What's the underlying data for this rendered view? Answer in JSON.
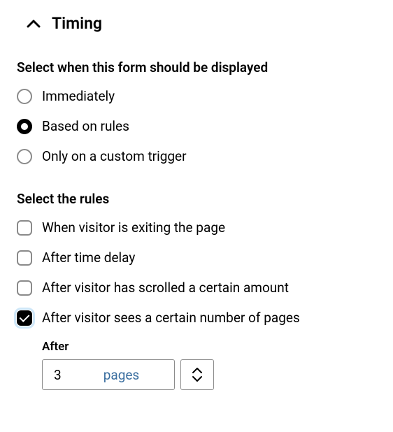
{
  "section": {
    "title": "Timing"
  },
  "display": {
    "label": "Select when this form should be displayed",
    "options": [
      {
        "label": "Immediately",
        "selected": false
      },
      {
        "label": "Based on rules",
        "selected": true
      },
      {
        "label": "Only on a custom trigger",
        "selected": false
      }
    ]
  },
  "rules": {
    "label": "Select the rules",
    "options": [
      {
        "label": "When visitor is exiting the page",
        "checked": false
      },
      {
        "label": "After time delay",
        "checked": false
      },
      {
        "label": "After visitor has scrolled a certain amount",
        "checked": false
      },
      {
        "label": "After visitor sees a certain number of pages",
        "checked": true
      }
    ]
  },
  "pages_rule": {
    "label": "After",
    "value": "3",
    "unit": "pages"
  }
}
